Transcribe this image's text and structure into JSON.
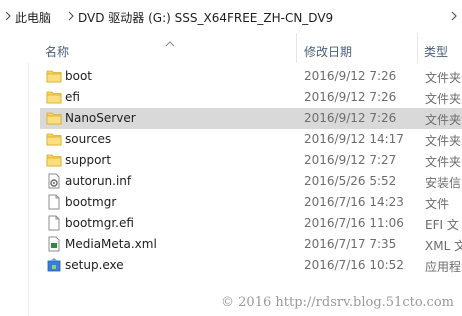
{
  "breadcrumb": {
    "segments": [
      "此电脑",
      "DVD 驱动器 (G:) SSS_X64FREE_ZH-CN_DV9"
    ]
  },
  "columns": {
    "name": "名称",
    "date": "修改日期",
    "type": "类型"
  },
  "files": [
    {
      "name": "boot",
      "date": "2016/9/12 7:26",
      "type": "文件夹",
      "icon": "folder-icon"
    },
    {
      "name": "efi",
      "date": "2016/9/12 7:26",
      "type": "文件夹",
      "icon": "folder-icon"
    },
    {
      "name": "NanoServer",
      "date": "2016/9/12 7:26",
      "type": "文件夹",
      "icon": "folder-icon"
    },
    {
      "name": "sources",
      "date": "2016/9/12 14:17",
      "type": "文件夹",
      "icon": "folder-icon"
    },
    {
      "name": "support",
      "date": "2016/9/12 7:27",
      "type": "文件夹",
      "icon": "folder-icon"
    },
    {
      "name": "autorun.inf",
      "date": "2016/5/26 5:52",
      "type": "安装信",
      "icon": "settings-file-icon"
    },
    {
      "name": "bootmgr",
      "date": "2016/7/16 14:23",
      "type": "文件",
      "icon": "blank-file-icon"
    },
    {
      "name": "bootmgr.efi",
      "date": "2016/7/16 11:06",
      "type": "EFI 文",
      "icon": "blank-file-icon"
    },
    {
      "name": "MediaMeta.xml",
      "date": "2016/7/17 7:35",
      "type": "XML 文",
      "icon": "xml-file-icon"
    },
    {
      "name": "setup.exe",
      "date": "2016/7/16 10:52",
      "type": "应用程",
      "icon": "setup-app-icon"
    }
  ],
  "selected_index": 2,
  "watermark": "© 2016 http://rdsrv.blog.51cto.com",
  "colors": {
    "folder": "#f7d25c",
    "selection": "#d9d9d9",
    "header_text": "#4c607a"
  }
}
